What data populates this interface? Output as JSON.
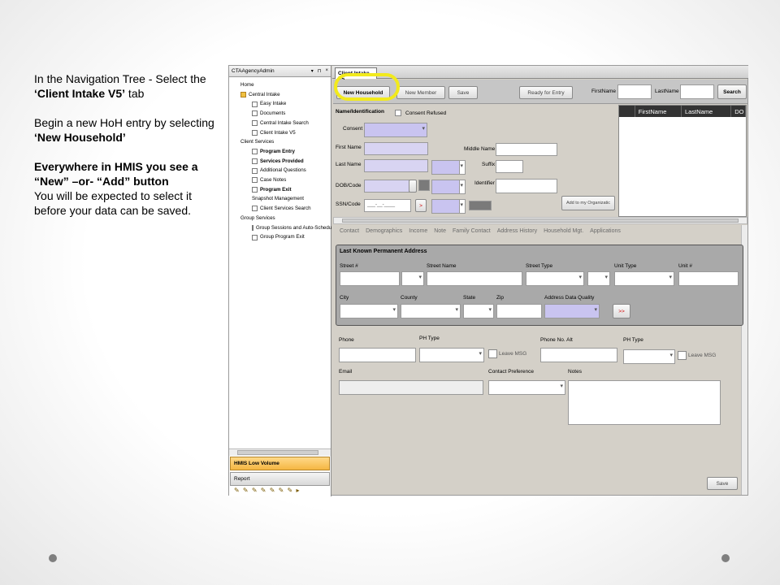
{
  "instructions": {
    "p1_part1": "In the Navigation Tree  -  Select the ",
    "p1_bold": "‘Client Intake V5’",
    "p1_part2": " tab",
    "p2_part1": "Begin a new HoH entry by selecting ",
    "p2_bold": "‘New Household’",
    "p3_bold": "Everywhere in HMIS you see a “New” –or- “Add” button",
    "p3_rest": "You will be expected to select it before your data can be saved."
  },
  "nav": {
    "header": "CTAAgencyAdmin",
    "header_ctrls": [
      "▾",
      "⊓",
      "×"
    ],
    "tree": [
      {
        "label": "Home",
        "level": 1,
        "icon": "none",
        "bold": false
      },
      {
        "label": "Central Intake",
        "level": 1,
        "icon": "folder",
        "bold": false
      },
      {
        "label": "Easy Intake",
        "level": 2,
        "icon": "doc",
        "bold": false
      },
      {
        "label": "Documents",
        "level": 2,
        "icon": "doc",
        "bold": false
      },
      {
        "label": "Central Intake Search",
        "level": 2,
        "icon": "doc",
        "bold": false
      },
      {
        "label": "Client Intake V5",
        "level": 2,
        "icon": "doc",
        "bold": false
      },
      {
        "label": "Client Services",
        "level": 1,
        "icon": "none",
        "bold": false
      },
      {
        "label": "Program Entry",
        "level": 2,
        "icon": "doc",
        "bold": true
      },
      {
        "label": "Services Provided",
        "level": 2,
        "icon": "doc",
        "bold": true
      },
      {
        "label": "Additional Questions",
        "level": 2,
        "icon": "doc",
        "bold": false
      },
      {
        "label": "Case Notes",
        "level": 2,
        "icon": "doc",
        "bold": false
      },
      {
        "label": "Program Exit",
        "level": 2,
        "icon": "doc",
        "bold": true
      },
      {
        "label": "Snapshot Management",
        "level": 2,
        "icon": "none",
        "bold": false
      },
      {
        "label": "Client Services Search",
        "level": 2,
        "icon": "doc",
        "bold": false
      },
      {
        "label": "Group Services",
        "level": 1,
        "icon": "none",
        "bold": false
      },
      {
        "label": "Group Sessions and Auto-Schedu",
        "level": 2,
        "icon": "doc",
        "bold": false
      },
      {
        "label": "Group Program Exit",
        "level": 2,
        "icon": "doc",
        "bold": false
      }
    ],
    "hmis_button": "HMIS Low Volume",
    "report_button": "Report",
    "icon_strip": "✎ ✎ ✎ ✎ ✎ ✎ ✎ ▸"
  },
  "main": {
    "tab": "Client Intake V5",
    "toolbar": {
      "new_household": "New Household",
      "new_member": "New Member",
      "save": "Save",
      "ready_for_entry": "Ready for Entry",
      "firstname_label": "FirstName",
      "lastname_label": "LastName",
      "search": "Search"
    },
    "grid_columns": [
      "",
      "FirstName",
      "LastName",
      "DO"
    ],
    "form": {
      "section_label": "Name/Identification",
      "consent_refused": "Consent Refused",
      "consent": "Consent",
      "first_name": "First Name",
      "middle_name": "Middle Name",
      "last_name": "Last Name",
      "suffix": "Suffix",
      "dob_code": "DOB/Code",
      "identifier": "Identifier",
      "ssn_code": "SSN/Code",
      "ssn_placeholder": "___-__-____",
      "add_to_org": "Add to my Organizatic"
    },
    "subtabs": [
      "Contact",
      "Demographics",
      "Income",
      "Note",
      "Family Contact",
      "Address History",
      "Household Mgt.",
      "Applications"
    ],
    "address": {
      "title": "Last Known Permanent Address",
      "street_no": "Street #",
      "street_name": "Street Name",
      "street_type": "Street Type",
      "unit_type": "Unit Type",
      "unit_no": "Unit #",
      "city": "City",
      "county": "County",
      "state": "State",
      "zip": "Zip",
      "quality": "Address Data Quality",
      "arrow": ">>"
    },
    "contact": {
      "phone": "Phone",
      "ph_type": "PH Type",
      "leave_msg": "Leave MSG",
      "phone_alt": "Phone No. Alt",
      "ph_type2": "PH Type",
      "leave_msg2": "Leave MSG",
      "email": "Email",
      "contact_pref": "Contact Preference",
      "notes": "Notes"
    },
    "save_bottom": "Save"
  }
}
